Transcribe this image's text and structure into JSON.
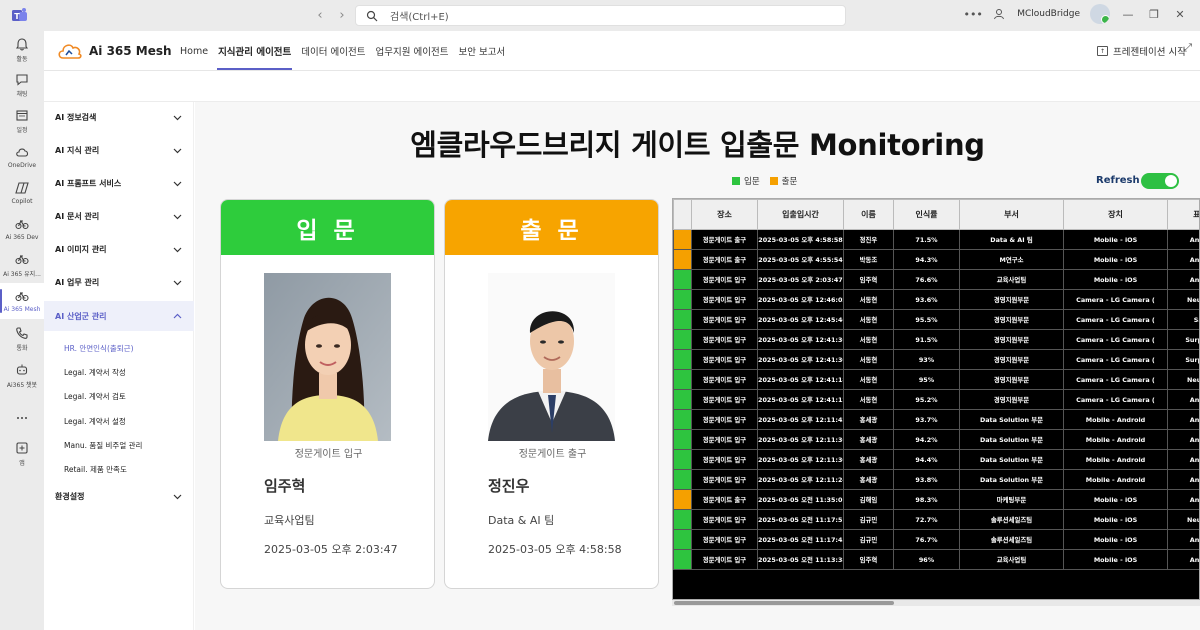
{
  "titlebar": {
    "search_placeholder": "검색(Ctrl+E)",
    "org_name": "MCloudBridge"
  },
  "rail": [
    {
      "label": "활동",
      "icon": "bell-icon"
    },
    {
      "label": "채팅",
      "icon": "chat-icon"
    },
    {
      "label": "일정",
      "icon": "calendar-icon"
    },
    {
      "label": "OneDrive",
      "icon": "cloud-icon"
    },
    {
      "label": "Copilot",
      "icon": "copilot-icon"
    },
    {
      "label": "Ai 365 Dev",
      "icon": "bike-icon"
    },
    {
      "label": "Ai 365 유지...",
      "icon": "bike-icon"
    },
    {
      "label": "Ai 365 Mesh",
      "icon": "bike-icon"
    },
    {
      "label": "통화",
      "icon": "phone-icon"
    },
    {
      "label": "Ai365 챗봇",
      "icon": "bot-icon"
    },
    {
      "label": "",
      "icon": "more-icon"
    },
    {
      "label": "앱",
      "icon": "add-app-icon"
    }
  ],
  "header": {
    "brand": "Ai 365 Mesh",
    "tabs": [
      "Home",
      "지식관리 에이전트",
      "데이터 에이전트",
      "업무지원 에이전트",
      "보안 보고서"
    ],
    "active_tab": "지식관리 에이전트",
    "present_label": "프레젠테이션 시작"
  },
  "sidebar": {
    "menu": [
      {
        "label": "AI 정보검색"
      },
      {
        "label": "AI 지식 관리"
      },
      {
        "label": "AI 프롬프트 서비스"
      },
      {
        "label": "AI 문서 관리"
      },
      {
        "label": "AI 이미지 관리"
      },
      {
        "label": "AI 업무 관리"
      },
      {
        "label": "AI 산업군 관리"
      }
    ],
    "submenu": [
      "HR. 안면인식(출퇴근)",
      "Legal. 계약서 작성",
      "Legal. 계약서 검토",
      "Legal. 계약서 설정",
      "Manu. 품질 비주얼 관리",
      "Retail. 제품 만족도"
    ],
    "settings": "환경설정"
  },
  "main": {
    "title": "엠클라우드브리지 게이트 입출문 Monitoring",
    "legend": [
      {
        "label": "입문",
        "color": "#2ec43f"
      },
      {
        "label": "출문",
        "color": "#f5a000"
      }
    ],
    "refresh_label": "Refresh",
    "refresh_on": true,
    "entry_card": {
      "header": "입 문",
      "color": "#2ecc3c",
      "location": "정문게이트 입구",
      "name": "임주혁",
      "department": "교육사업팀",
      "time": "2025-03-05 오후 2:03:47"
    },
    "exit_card": {
      "header": "출 문",
      "color": "#f7a400",
      "location": "정문게이트 출구",
      "name": "정진우",
      "department": "Data & AI 팀",
      "time": "2025-03-05 오후 4:58:58"
    }
  },
  "table": {
    "columns": [
      "장소",
      "입출입시간",
      "이름",
      "인식률",
      "부서",
      "장치",
      "표정"
    ],
    "rows": [
      {
        "type": "out",
        "place": "정문게이트 출구",
        "time": "2025-03-05 오후 4:58:58",
        "name": "정진우",
        "rate": "71.5%",
        "dept": "Data & AI 팀",
        "device": "Mobile - iOS",
        "emotion": "Angry"
      },
      {
        "type": "out",
        "place": "정문게이트 출구",
        "time": "2025-03-05 오후 4:55:54",
        "name": "박동조",
        "rate": "94.3%",
        "dept": "M연구소",
        "device": "Mobile - iOS",
        "emotion": "Angry"
      },
      {
        "type": "in",
        "place": "정문게이트 입구",
        "time": "2025-03-05 오후 2:03:47",
        "name": "임주혁",
        "rate": "76.6%",
        "dept": "교육사업팀",
        "device": "Mobile - iOS",
        "emotion": "Angry"
      },
      {
        "type": "in",
        "place": "정문게이트 입구",
        "time": "2025-03-05 오후 12:46:02",
        "name": "서동현",
        "rate": "93.6%",
        "dept": "경영지원부문",
        "device": "Camera - LG Camera (",
        "emotion": "Neutral"
      },
      {
        "type": "in",
        "place": "정문게이트 입구",
        "time": "2025-03-05 오후 12:45:46",
        "name": "서동현",
        "rate": "95.5%",
        "dept": "경영지원부문",
        "device": "Camera - LG Camera (",
        "emotion": "Sad"
      },
      {
        "type": "in",
        "place": "정문게이트 입구",
        "time": "2025-03-05 오후 12:41:36",
        "name": "서동현",
        "rate": "91.5%",
        "dept": "경영지원부문",
        "device": "Camera - LG Camera (",
        "emotion": "Surprise"
      },
      {
        "type": "in",
        "place": "정문게이트 입구",
        "time": "2025-03-05 오후 12:41:30",
        "name": "서동현",
        "rate": "93%",
        "dept": "경영지원부문",
        "device": "Camera - LG Camera (",
        "emotion": "Surprise"
      },
      {
        "type": "in",
        "place": "정문게이트 입구",
        "time": "2025-03-05 오후 12:41:18",
        "name": "서동현",
        "rate": "95%",
        "dept": "경영지원부문",
        "device": "Camera - LG Camera (",
        "emotion": "Neutral"
      },
      {
        "type": "in",
        "place": "정문게이트 입구",
        "time": "2025-03-05 오후 12:41:12",
        "name": "서동현",
        "rate": "95.2%",
        "dept": "경영지원부문",
        "device": "Camera - LG Camera (",
        "emotion": "Angry"
      },
      {
        "type": "in",
        "place": "정문게이트 입구",
        "time": "2025-03-05 오후 12:11:42",
        "name": "홍세광",
        "rate": "93.7%",
        "dept": "Data Solution 부문",
        "device": "Mobile - Android",
        "emotion": "Angry"
      },
      {
        "type": "in",
        "place": "정문게이트 입구",
        "time": "2025-03-05 오후 12:11:36",
        "name": "홍세광",
        "rate": "94.2%",
        "dept": "Data Solution 부문",
        "device": "Mobile - Android",
        "emotion": "Angry"
      },
      {
        "type": "in",
        "place": "정문게이트 입구",
        "time": "2025-03-05 오후 12:11:30",
        "name": "홍세광",
        "rate": "94.4%",
        "dept": "Data Solution 부문",
        "device": "Mobile - Android",
        "emotion": "Angry"
      },
      {
        "type": "in",
        "place": "정문게이트 입구",
        "time": "2025-03-05 오후 12:11:24",
        "name": "홍세광",
        "rate": "93.8%",
        "dept": "Data Solution 부문",
        "device": "Mobile - Android",
        "emotion": "Angry"
      },
      {
        "type": "out",
        "place": "정문게이트 출구",
        "time": "2025-03-05 오전 11:35:01",
        "name": "김해임",
        "rate": "98.3%",
        "dept": "마케팅부문",
        "device": "Mobile - iOS",
        "emotion": "Angry"
      },
      {
        "type": "in",
        "place": "정문게이트 입구",
        "time": "2025-03-05 오전 11:17:51",
        "name": "김규민",
        "rate": "72.7%",
        "dept": "솔루션세일즈팀",
        "device": "Mobile - iOS",
        "emotion": "Neutral"
      },
      {
        "type": "in",
        "place": "정문게이트 입구",
        "time": "2025-03-05 오전 11:17:45",
        "name": "김규민",
        "rate": "76.7%",
        "dept": "솔루션세일즈팀",
        "device": "Mobile - iOS",
        "emotion": "Angry"
      },
      {
        "type": "in",
        "place": "정문게이트 입구",
        "time": "2025-03-05 오전 11:13:38",
        "name": "임주혁",
        "rate": "96%",
        "dept": "교육사업팀",
        "device": "Mobile - iOS",
        "emotion": "Angry"
      }
    ]
  }
}
